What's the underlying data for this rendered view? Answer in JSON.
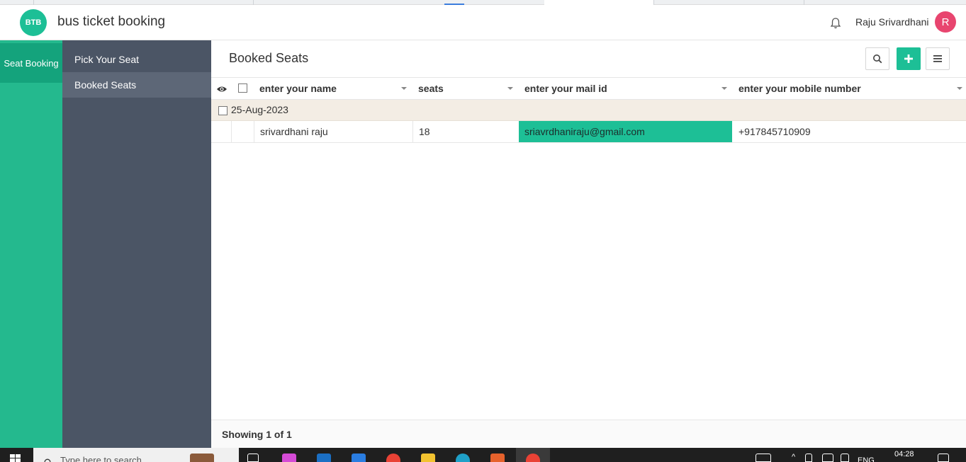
{
  "header": {
    "logo_text": "BTB",
    "app_title": "bus ticket booking",
    "user_name": "Raju Srivardhani",
    "avatar_initial": "R"
  },
  "rail": {
    "items": [
      {
        "label": "Seat Booking",
        "active": true
      }
    ]
  },
  "subnav": {
    "items": [
      {
        "label": "Pick Your Seat",
        "active": false
      },
      {
        "label": "Booked Seats",
        "active": true
      }
    ]
  },
  "page": {
    "title": "Booked Seats",
    "toolbar": {
      "search_icon": "search-icon",
      "add_icon": "plus-icon",
      "menu_icon": "hamburger-icon"
    }
  },
  "grid": {
    "columns": [
      "enter your name",
      "seats",
      "enter your mail id",
      "enter your mobile number"
    ],
    "groups": [
      {
        "label": "25-Aug-2023",
        "rows": [
          {
            "name": "srivardhani raju",
            "seats": "18",
            "email": "sriavrdhaniraju@gmail.com",
            "mobile": "+917845710909"
          }
        ]
      }
    ],
    "footer": "Showing 1 of 1"
  },
  "taskbar": {
    "search_placeholder": "Type here to search",
    "language": "ENG",
    "time": "04:28"
  },
  "colors": {
    "accent": "#1dbf96",
    "rail": "#24b98e",
    "subnav": "#4b5565",
    "avatar": "#e8456f"
  }
}
